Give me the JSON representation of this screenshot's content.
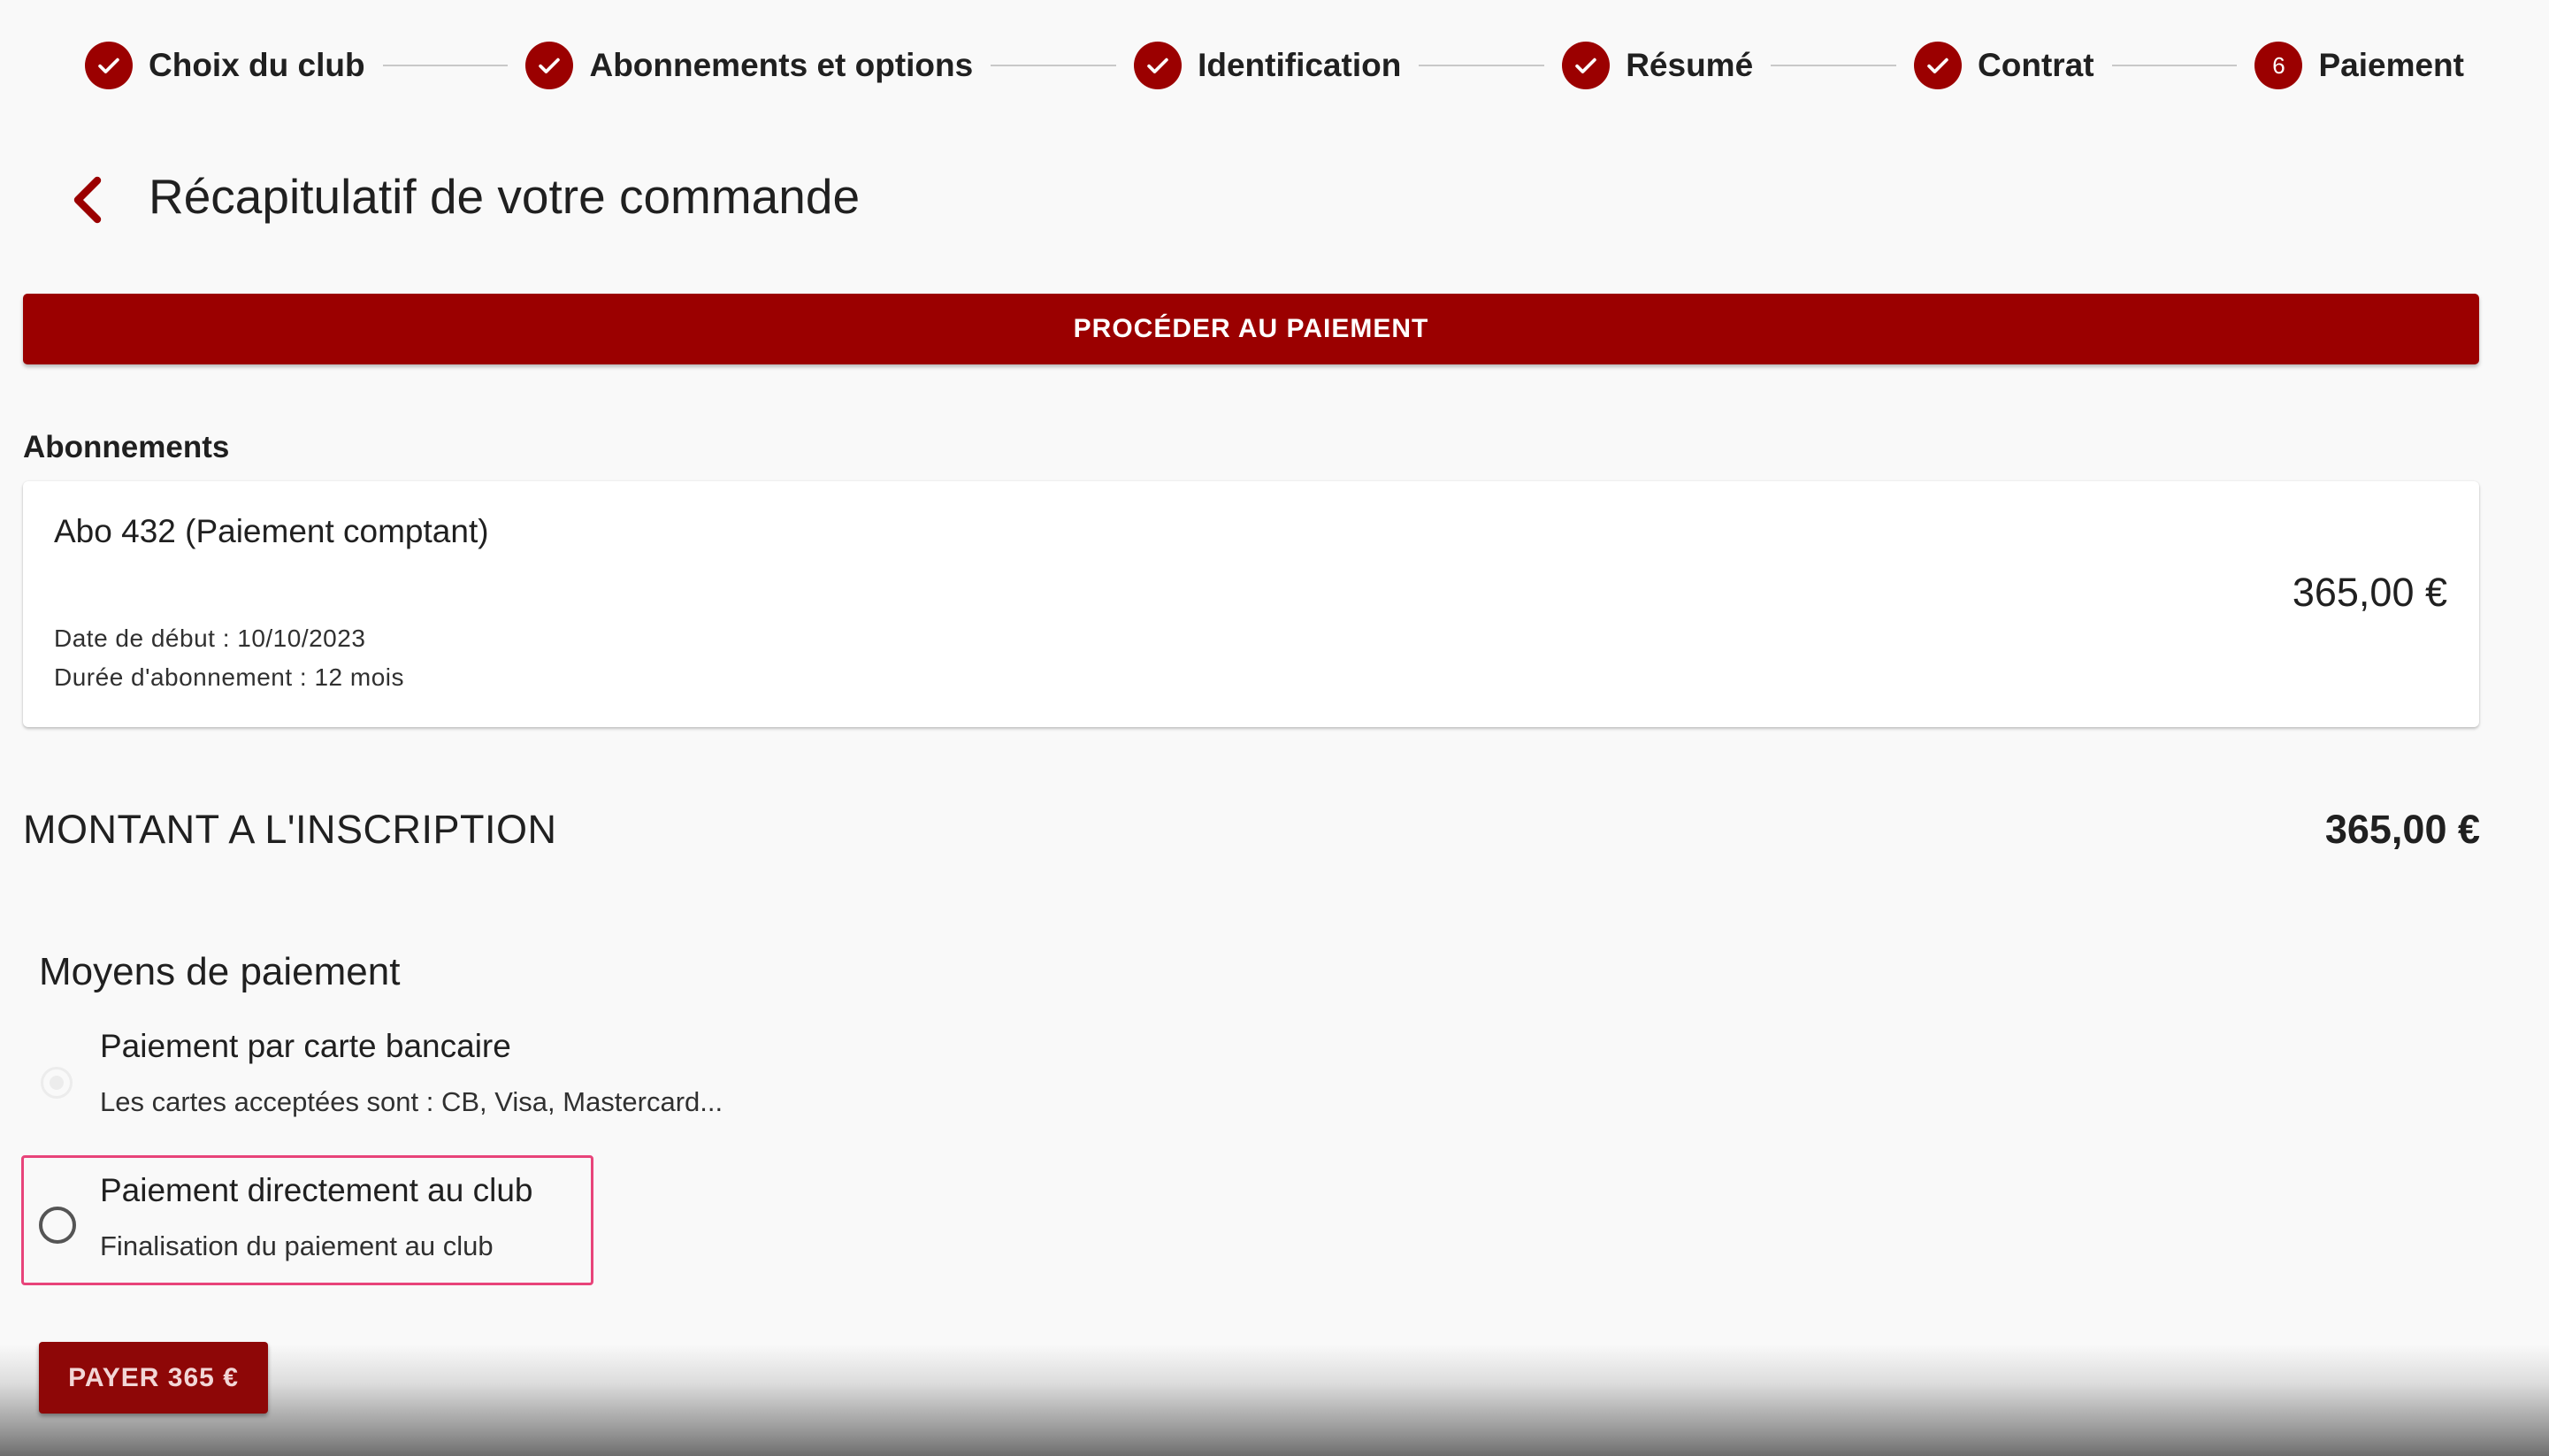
{
  "stepper": {
    "steps": [
      {
        "label": "Choix du club",
        "state": "done",
        "icon": "check-icon"
      },
      {
        "label": "Abonnements et options",
        "state": "done",
        "icon": "check-icon"
      },
      {
        "label": "Identification",
        "state": "done",
        "icon": "check-icon"
      },
      {
        "label": "Résumé",
        "state": "done",
        "icon": "check-icon"
      },
      {
        "label": "Contrat",
        "state": "done",
        "icon": "check-icon"
      },
      {
        "label": "Paiement",
        "state": "current",
        "number": "6"
      }
    ]
  },
  "header": {
    "back_icon": "chevron-left-icon",
    "title": "Récapitulatif de votre commande"
  },
  "proceed_button": {
    "label": "PROCÉDER AU PAIEMENT"
  },
  "subscriptions": {
    "section_label": "Abonnements",
    "items": [
      {
        "name": "Abo 432 (Paiement comptant)",
        "start_date": "Date de début : 10/10/2023",
        "duration": "Durée d'abonnement : 12 mois",
        "price": "365,00 €"
      }
    ]
  },
  "total": {
    "label": "MONTANT A L'INSCRIPTION",
    "amount": "365,00 €"
  },
  "payment_methods": {
    "title": "Moyens de paiement",
    "options": [
      {
        "title": "Paiement par carte bancaire",
        "description": "Les cartes acceptées sont : CB, Visa, Mastercard...",
        "state": "disabled"
      },
      {
        "title": "Paiement directement au club",
        "description": "Finalisation du paiement au club",
        "state": "unselected",
        "highlighted": true
      }
    ]
  },
  "pay_button": {
    "label": "PAYER 365 €"
  },
  "colors": {
    "brand_red": "#9b0000",
    "highlight_border": "#e8447a",
    "background": "#f9f9f9"
  }
}
